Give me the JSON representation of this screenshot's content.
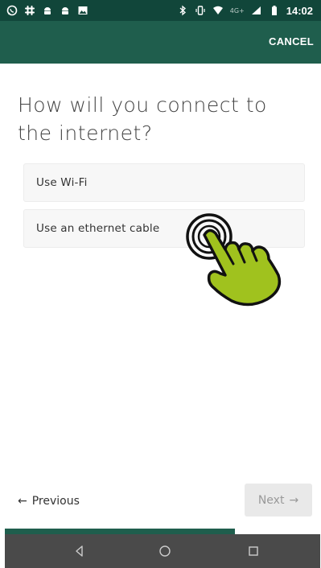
{
  "status_bar": {
    "left_icons": [
      "whatsapp-icon",
      "slack-icon",
      "android-icon",
      "android-icon",
      "image-icon"
    ],
    "right_icons": [
      "bluetooth-icon",
      "vibrate-icon",
      "wifi-icon",
      "signal-4g-icon",
      "battery-icon"
    ],
    "network_label": "4G+",
    "time": "14:02"
  },
  "app_bar": {
    "cancel_label": "CANCEL",
    "color": "#1f5e4d",
    "status_color": "#11463a"
  },
  "main": {
    "title": "How will you connect to the internet?",
    "options": [
      {
        "label": "Use Wi-Fi"
      },
      {
        "label": "Use an ethernet cable"
      }
    ],
    "tap_indicator_icon": "tap-hand-icon",
    "tap_indicator_color": "#9bbd22"
  },
  "footer": {
    "previous_label": "Previous",
    "previous_icon": "arrow-left-icon",
    "next_label": "Next",
    "next_icon": "arrow-right-icon",
    "progress_fraction": 0.73
  },
  "nav_bar": {
    "icons": [
      "back-icon",
      "home-icon",
      "recents-icon"
    ]
  }
}
